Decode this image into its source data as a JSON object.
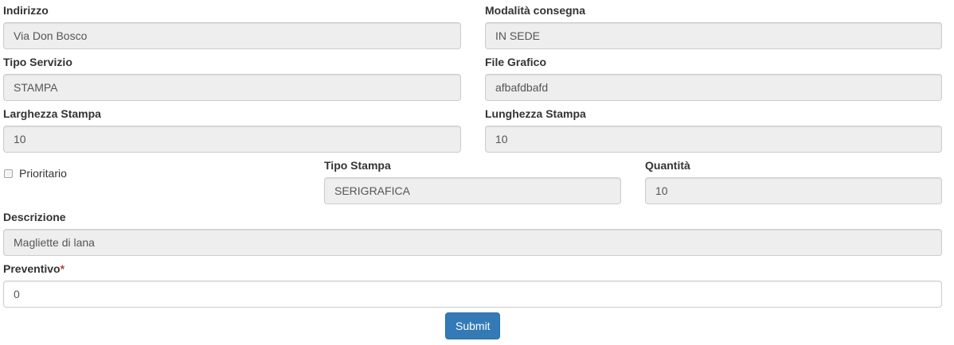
{
  "form": {
    "indirizzo": {
      "label": "Indirizzo",
      "value": "Via Don Bosco"
    },
    "modalita_consegna": {
      "label": "Modalità consegna",
      "value": "IN SEDE"
    },
    "tipo_servizio": {
      "label": "Tipo Servizio",
      "value": "STAMPA"
    },
    "file_grafico": {
      "label": "File Grafico",
      "value": "afbafdbafd"
    },
    "larghezza_stampa": {
      "label": "Larghezza Stampa",
      "value": "10"
    },
    "lunghezza_stampa": {
      "label": "Lunghezza Stampa",
      "value": "10"
    },
    "prioritario": {
      "label": "Prioritario",
      "checked": false
    },
    "tipo_stampa": {
      "label": "Tipo Stampa",
      "value": "SERIGRAFICA"
    },
    "quantita": {
      "label": "Quantità",
      "value": "10"
    },
    "descrizione": {
      "label": "Descrizione",
      "value": "Magliette di lana"
    },
    "preventivo": {
      "label": "Preventivo",
      "required_mark": "*",
      "value": "0"
    },
    "submit_label": "Submit"
  },
  "colors": {
    "readonly_bg": "#eeeeee",
    "border": "#cccccc",
    "primary": "#337ab7",
    "required": "#a94442"
  }
}
